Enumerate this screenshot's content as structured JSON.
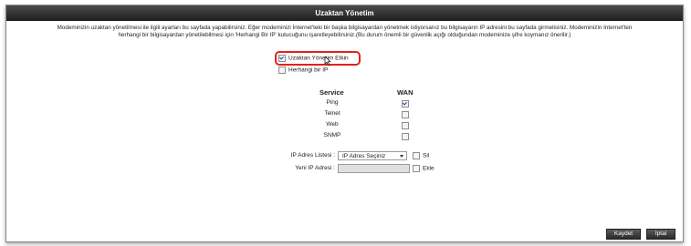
{
  "title": "Uzaktan Yönetim",
  "description": {
    "line1": "Modeminizin uzaktan yönetilmesi ile ilgili ayarları bu sayfada yapabilirsiniz. Eğer modeminizi İnternet'teki bir başka bilgisayardan yönetmek istiyorsanız bu bilgisayarın IP adresini bu sayfada girmelisiniz. Modeminizin Internet'ten",
    "line2": "herhangi bir bilgisayardan yönetilebilmesi için 'Herhangi Bir IP' kutucuğunu işaretleyebilirsiniz.(Bu durum önemli bir güvenlik açığı olduğundan modeminize şifre koymanız önerilir.)"
  },
  "remote_mgmt": {
    "label": "Uzaktan Yönetim Etkin",
    "checked": true
  },
  "any_ip": {
    "label": "Herhangi bir IP",
    "checked": false
  },
  "services": {
    "col_service": "Service",
    "col_wan": "WAN",
    "rows": [
      {
        "name": "Ping",
        "wan": true
      },
      {
        "name": "Telnet",
        "wan": false
      },
      {
        "name": "Web",
        "wan": false
      },
      {
        "name": "SNMP",
        "wan": false
      }
    ]
  },
  "ip_list": {
    "label": "IP Adres Listesi :",
    "selected": "IP Adres Seçiniz",
    "delete_label": "Sil"
  },
  "new_ip": {
    "label": "Yeni IP Adresi :",
    "value": "",
    "add_label": "Ekle"
  },
  "buttons": {
    "save": "Kaydet",
    "cancel": "İptal"
  }
}
